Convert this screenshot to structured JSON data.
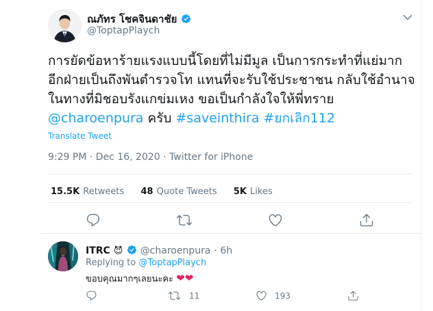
{
  "tweet": {
    "display_name": "ณภัทร โชคจินดาชัย",
    "handle": "@ToptapPlaych",
    "text_plain": "การยัดข้อหาร้ายแรงแบบนี้โดยที่ไม่มีมูล เป็นการกระทำที่แย่มาก อีกฝ่ายเป็นถึงพันตำรวจโท แทนที่จะรับใช้ประชาชน กลับใช้อำนาจในทางที่มิชอบรังแกข่มเหง ขอเป็นกำลังใจให้พี่ทราย ",
    "mention": "@charoenpura",
    "after_mention": " ครับ ",
    "hashtag1": "#saveinthira",
    "hashtag2": "#ยกเลิก112",
    "translate_label": "Translate Tweet",
    "time": "9:29 PM",
    "date": "Dec 16, 2020",
    "source": "Twitter for iPhone",
    "retweets_count": "15.5K",
    "retweets_label": "Retweets",
    "quotes_count": "48",
    "quotes_label": "Quote Tweets",
    "likes_count": "5K",
    "likes_label": "Likes"
  },
  "reply": {
    "display_name": "ITRC",
    "emoji": "😈",
    "handle": "@charoenpura",
    "time_ago": "6h",
    "replying_to_label": "Replying to",
    "replying_to_handle": "@ToptapPlaych",
    "text": "ขอบคุณมากๆเลยนะคะ",
    "hearts": "❤❤",
    "retweets": "11",
    "likes": "193"
  },
  "colors": {
    "accent": "#1da1f2",
    "muted": "#657786",
    "heart": "#e0245e"
  },
  "icons": [
    "verified-badge-icon",
    "more-icon",
    "reply-icon",
    "retweet-icon",
    "like-icon",
    "share-icon"
  ]
}
